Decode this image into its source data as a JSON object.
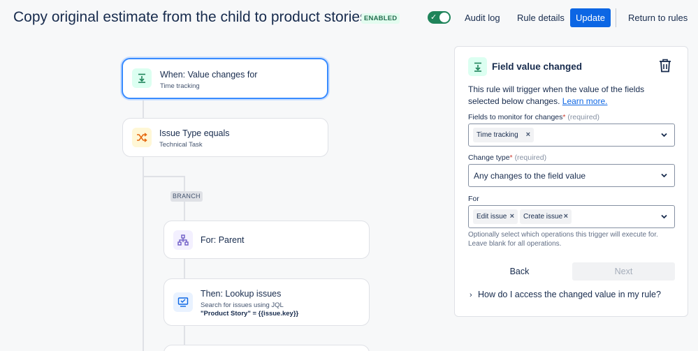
{
  "header": {
    "title": "Copy original estimate from the child to product stories",
    "status_badge": "ENABLED",
    "toggle_on": true,
    "audit_log": "Audit log",
    "rule_details": "Rule details",
    "update": "Update",
    "return_to_rules": "Return to rules"
  },
  "flow": {
    "trigger": {
      "title": "When: Value changes for",
      "subtitle": "Time tracking",
      "icon": "field-change-icon",
      "selected": true
    },
    "condition": {
      "title": "Issue Type equals",
      "subtitle": "Technical Task",
      "icon": "shuffle-icon"
    },
    "branch_tag": "BRANCH",
    "branch": {
      "title": "For: Parent",
      "icon": "hierarchy-icon"
    },
    "action": {
      "title": "Then: Lookup issues",
      "subtitle_line1": "Search for issues using JQL",
      "subtitle_bold": "\"Product Story\"",
      "subtitle_rest": " = {{issue.key}}",
      "icon": "lookup-icon"
    }
  },
  "panel": {
    "title": "Field value changed",
    "description": "This rule will trigger when the value of the fields selected below changes.",
    "learn_more": "Learn more.",
    "fields_label": "Fields to monitor for changes",
    "required_text": "(required)",
    "fields_tags": [
      "Time tracking"
    ],
    "change_type_label": "Change type",
    "change_type_value": "Any changes to the field value",
    "for_label": "For",
    "for_tags": [
      "Edit issue",
      "Create issue"
    ],
    "helper_text": "Optionally select which operations this trigger will execute for. Leave blank for all operations.",
    "back": "Back",
    "next": "Next",
    "expander": "How do I access the changed value in my rule?"
  },
  "colors": {
    "primary": "#0c66e4",
    "toggle_on": "#1f845a",
    "enabled_badge_bg": "#e3fcef",
    "selected_border": "#388bff"
  }
}
